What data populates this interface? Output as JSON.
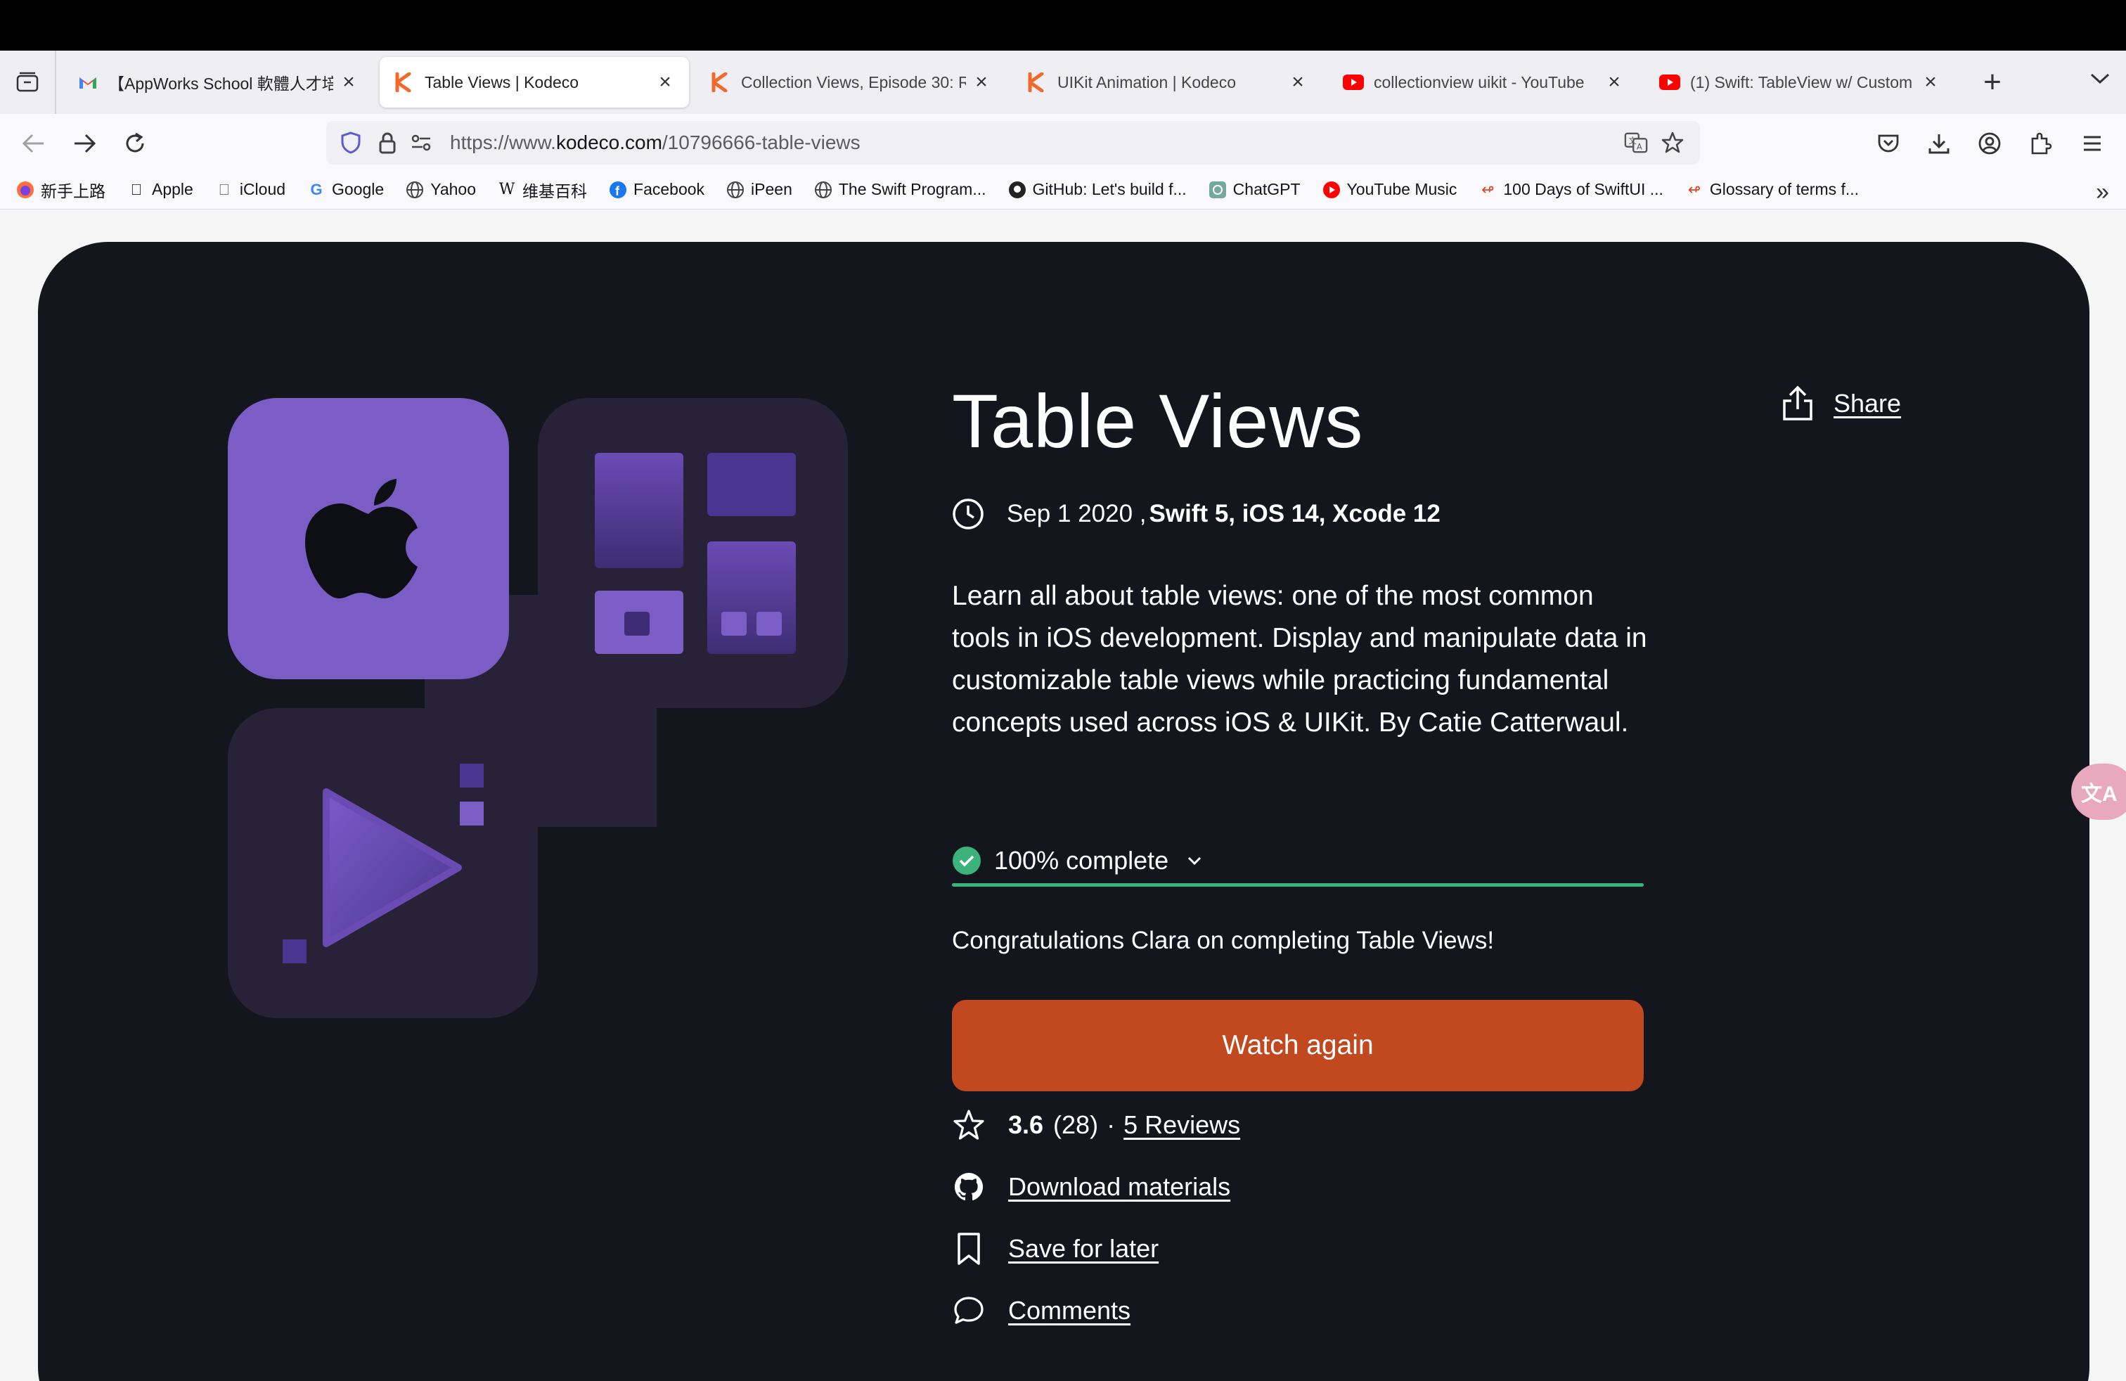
{
  "tabs": [
    {
      "title": "【AppWorks School 軟體人才培訓",
      "icon": "gmail-icon",
      "active": false
    },
    {
      "title": "Table Views | Kodeco",
      "icon": "kodeco-icon",
      "active": true
    },
    {
      "title": "Collection Views, Episode 30: R",
      "icon": "kodeco-icon",
      "active": false
    },
    {
      "title": "UIKit Animation | Kodeco",
      "icon": "kodeco-icon",
      "active": false
    },
    {
      "title": "collectionview uikit - YouTube",
      "icon": "youtube-icon",
      "active": false
    },
    {
      "title": "(1) Swift: TableView w/ Custom C",
      "icon": "youtube-icon",
      "active": false
    }
  ],
  "url": {
    "prefix": "https://www.",
    "domain": "kodeco.com",
    "path": "/10796666-table-views"
  },
  "bookmarks": [
    {
      "label": "新手上路",
      "icon": "firefox-icon"
    },
    {
      "label": "Apple",
      "icon": "apple-icon"
    },
    {
      "label": "iCloud",
      "icon": "apple-icon"
    },
    {
      "label": "Google",
      "icon": "google-icon"
    },
    {
      "label": "Yahoo",
      "icon": "globe-icon"
    },
    {
      "label": "维基百科",
      "icon": "wikipedia-icon"
    },
    {
      "label": "Facebook",
      "icon": "facebook-icon"
    },
    {
      "label": "iPeen",
      "icon": "globe-icon"
    },
    {
      "label": "The Swift Program...",
      "icon": "globe-icon"
    },
    {
      "label": "GitHub: Let's build f...",
      "icon": "github-icon"
    },
    {
      "label": "ChatGPT",
      "icon": "chatgpt-icon"
    },
    {
      "label": "YouTube Music",
      "icon": "youtube-music-icon"
    },
    {
      "label": "100 Days of SwiftUI ...",
      "icon": "swift-icon"
    },
    {
      "label": "Glossary of terms f...",
      "icon": "swift-icon"
    }
  ],
  "course": {
    "title": "Table Views",
    "share_label": "Share",
    "date": "Sep 1 2020 ,",
    "tech": "Swift 5, iOS 14, Xcode 12",
    "description": "Learn all about table views: one of the most common tools in iOS development. Display and manipulate data in customizable table views while practicing fundamental concepts used across iOS & UIKit. By Catie Catterwaul.",
    "progress_label": "100% complete",
    "progress": 1.0,
    "congrats": "Congratulations Clara on completing Table Views!",
    "watch_label": "Watch again",
    "rating": "3.6",
    "rating_count": "(28)",
    "separator": "·",
    "reviews_label": "5 Reviews",
    "download_label": "Download materials",
    "save_label": "Save for later",
    "comments_label": "Comments"
  },
  "translate_badge": "文A",
  "colors": {
    "hero_bg": "#14161d",
    "accent_orange": "#c2491f",
    "progress_green": "#3bb37a",
    "art_purple": "#7b5dc6",
    "art_dark": "#272238"
  }
}
